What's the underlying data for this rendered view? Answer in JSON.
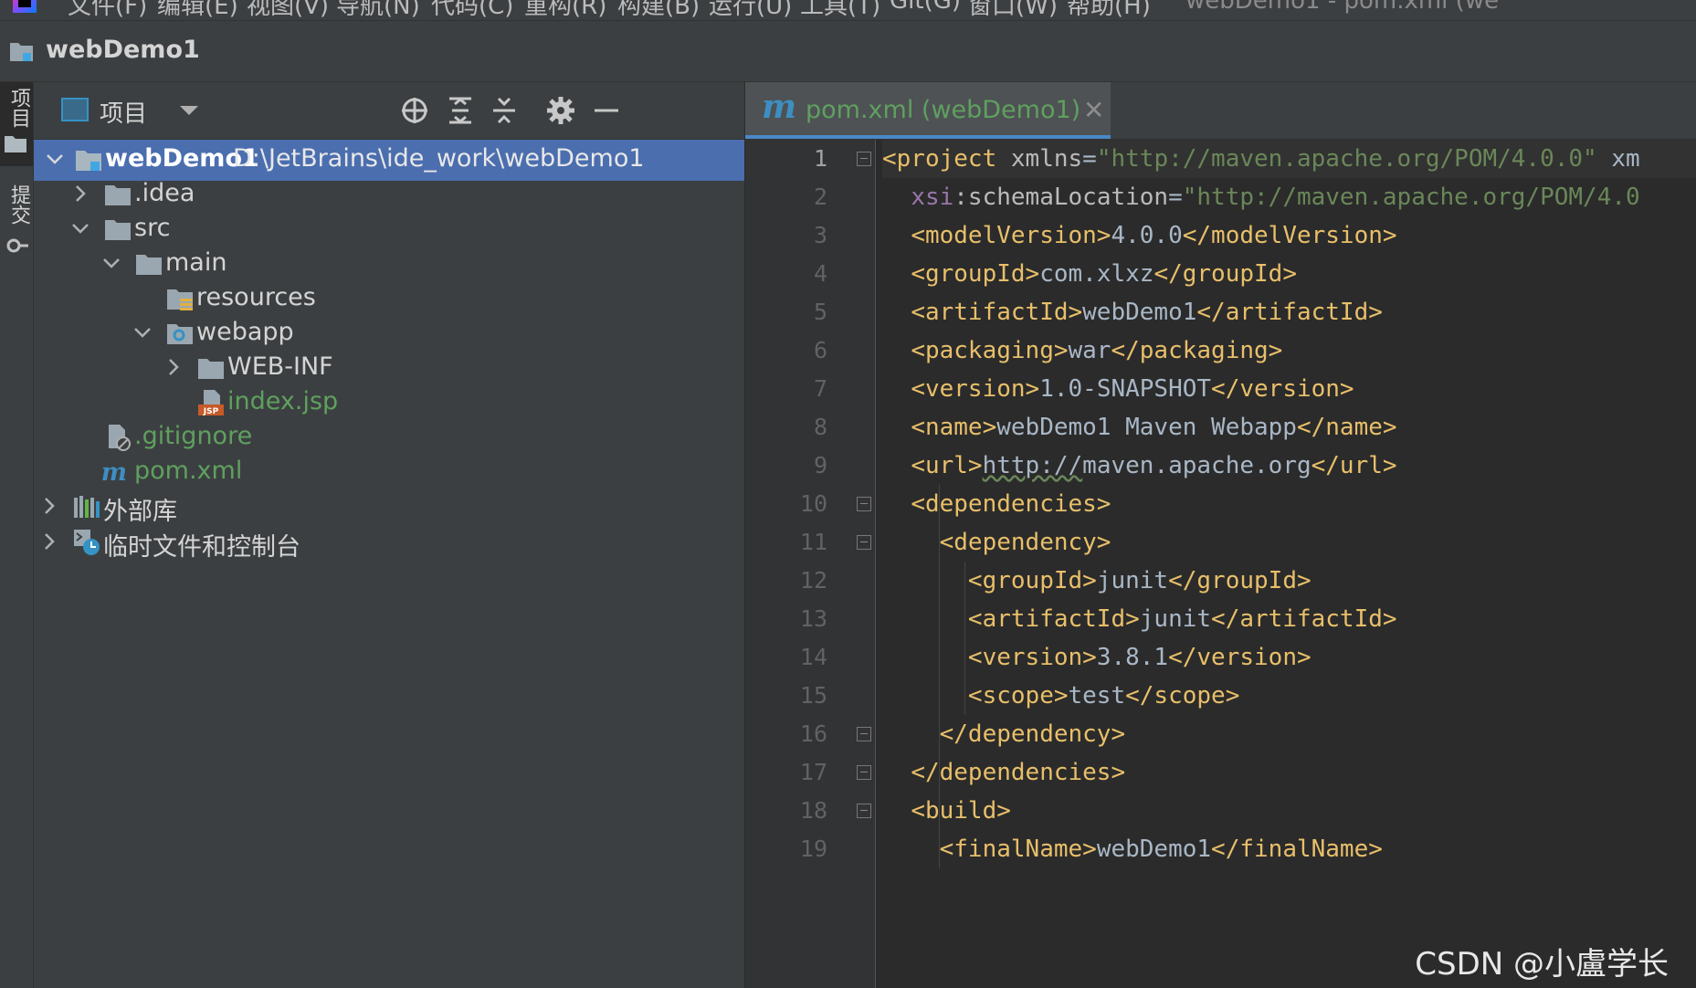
{
  "menubar": {
    "items": [
      "文件(F)",
      "编辑(E)",
      "视图(V)",
      "导航(N)",
      "代码(C)",
      "重构(R)",
      "构建(B)",
      "运行(U)",
      "工具(T)",
      "Git(G)",
      "窗口(W)",
      "帮助(H)"
    ],
    "window_title": "webDemo1 - pom.xml (we"
  },
  "navbar": {
    "project_name": "webDemo1"
  },
  "stripe": {
    "project_label": "项目",
    "commit_label": "提交"
  },
  "project_panel": {
    "view_mode": "项目",
    "tree": [
      {
        "label": "webDemo1",
        "path": "D:\\JetBrains\\ide_work\\webDemo1",
        "selected": true,
        "expanded": true
      },
      {
        "label": ".idea"
      },
      {
        "label": "src"
      },
      {
        "label": "main"
      },
      {
        "label": "resources"
      },
      {
        "label": "webapp"
      },
      {
        "label": "WEB-INF"
      },
      {
        "label": "index.jsp"
      },
      {
        "label": ".gitignore"
      },
      {
        "label": "pom.xml"
      },
      {
        "label": "外部库"
      },
      {
        "label": "临时文件和控制台"
      }
    ]
  },
  "editor": {
    "tab": {
      "icon_letter": "m",
      "label": "pom.xml (webDemo1)",
      "close": "✕"
    },
    "current_line": 1,
    "lines": [
      [
        [
          "tag",
          "<project"
        ],
        [
          "txt",
          " "
        ],
        [
          "attr",
          "xmlns"
        ],
        [
          "txt",
          "="
        ],
        [
          "str",
          "\"http://maven.apache.org/POM/4.0.0\""
        ],
        [
          "txt",
          " xm"
        ]
      ],
      [
        [
          "txt",
          "  "
        ],
        [
          "ns",
          "xsi"
        ],
        [
          "attr",
          ":schemaLocation"
        ],
        [
          "txt",
          "="
        ],
        [
          "str",
          "\"http://maven.apache.org/POM/4.0"
        ]
      ],
      [
        [
          "txt",
          "  "
        ],
        [
          "tag",
          "<modelVersion>"
        ],
        [
          "txt",
          "4.0.0"
        ],
        [
          "tag",
          "</modelVersion>"
        ]
      ],
      [
        [
          "txt",
          "  "
        ],
        [
          "tag",
          "<groupId>"
        ],
        [
          "txt",
          "com.xlxz"
        ],
        [
          "tag",
          "</groupId>"
        ]
      ],
      [
        [
          "txt",
          "  "
        ],
        [
          "tag",
          "<artifactId>"
        ],
        [
          "txt",
          "webDemo1"
        ],
        [
          "tag",
          "</artifactId>"
        ]
      ],
      [
        [
          "txt",
          "  "
        ],
        [
          "tag",
          "<packaging>"
        ],
        [
          "txt",
          "war"
        ],
        [
          "tag",
          "</packaging>"
        ]
      ],
      [
        [
          "txt",
          "  "
        ],
        [
          "tag",
          "<version>"
        ],
        [
          "txt",
          "1.0-SNAPSHOT"
        ],
        [
          "tag",
          "</version>"
        ]
      ],
      [
        [
          "txt",
          "  "
        ],
        [
          "tag",
          "<name>"
        ],
        [
          "txt",
          "webDemo1 Maven Webapp"
        ],
        [
          "tag",
          "</name>"
        ]
      ],
      [
        [
          "txt",
          "  "
        ],
        [
          "tag",
          "<url>"
        ],
        [
          "link",
          "http://"
        ],
        [
          "txt",
          "maven.apache.org"
        ],
        [
          "tag",
          "</url>"
        ]
      ],
      [
        [
          "txt",
          "  "
        ],
        [
          "tag",
          "<dependencies>"
        ]
      ],
      [
        [
          "txt",
          "    "
        ],
        [
          "tag",
          "<dependency>"
        ]
      ],
      [
        [
          "txt",
          "      "
        ],
        [
          "tag",
          "<groupId>"
        ],
        [
          "txt",
          "junit"
        ],
        [
          "tag",
          "</groupId>"
        ]
      ],
      [
        [
          "txt",
          "      "
        ],
        [
          "tag",
          "<artifactId>"
        ],
        [
          "txt",
          "junit"
        ],
        [
          "tag",
          "</artifactId>"
        ]
      ],
      [
        [
          "txt",
          "      "
        ],
        [
          "tag",
          "<version>"
        ],
        [
          "txt",
          "3.8.1"
        ],
        [
          "tag",
          "</version>"
        ]
      ],
      [
        [
          "txt",
          "      "
        ],
        [
          "tag",
          "<scope>"
        ],
        [
          "txt",
          "test"
        ],
        [
          "tag",
          "</scope>"
        ]
      ],
      [
        [
          "txt",
          "    "
        ],
        [
          "tag",
          "</dependency>"
        ]
      ],
      [
        [
          "txt",
          "  "
        ],
        [
          "tag",
          "</dependencies>"
        ]
      ],
      [
        [
          "txt",
          "  "
        ],
        [
          "tag",
          "<build>"
        ]
      ],
      [
        [
          "txt",
          "    "
        ],
        [
          "tag",
          "<finalName>"
        ],
        [
          "txt",
          "webDemo1"
        ],
        [
          "tag",
          "</finalName>"
        ]
      ]
    ]
  },
  "watermark": "CSDN @小盧学长",
  "colors": {
    "background": "#2b2b2b",
    "panel": "#3c3f41",
    "selection": "#4b6eaf",
    "tag": "#e8bf6a",
    "string": "#6a8759",
    "file_added_green": "#5fa05f",
    "accent": "#4a88c7"
  }
}
